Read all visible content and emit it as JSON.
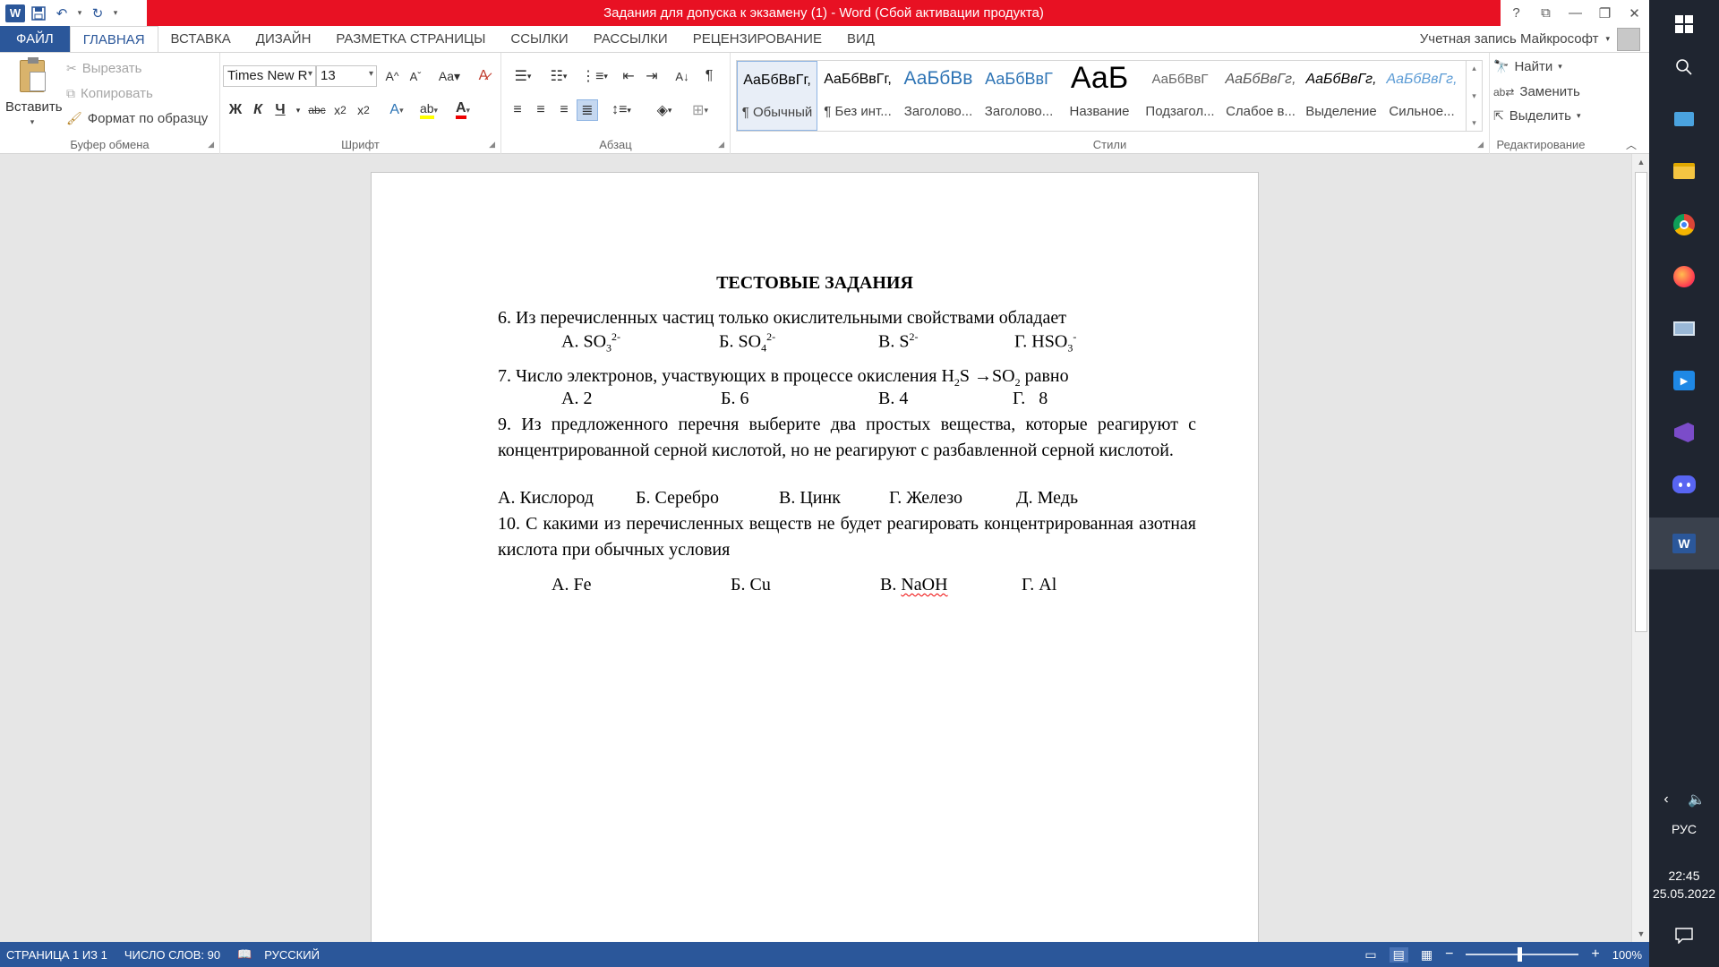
{
  "window": {
    "title": "Задания для допуска к экзамену (1) -  Word (Сбой активации продукта)",
    "controls": [
      "?",
      "⧉",
      "—",
      "❐",
      "✕"
    ]
  },
  "qat": {
    "icons": [
      "word-logo",
      "save-icon",
      "undo-icon",
      "redo-icon",
      "customize-icon"
    ]
  },
  "tabs": [
    {
      "label": "ФАЙЛ"
    },
    {
      "label": "ГЛАВНАЯ"
    },
    {
      "label": "ВСТАВКА"
    },
    {
      "label": "ДИЗАЙН"
    },
    {
      "label": "РАЗМЕТКА СТРАНИЦЫ"
    },
    {
      "label": "ССЫЛКИ"
    },
    {
      "label": "РАССЫЛКИ"
    },
    {
      "label": "РЕЦЕНЗИРОВАНИЕ"
    },
    {
      "label": "ВИД"
    }
  ],
  "account": {
    "label": "Учетная запись Майкрософт"
  },
  "ribbon": {
    "clipboard": {
      "group_label": "Буфер обмена",
      "paste": "Вставить",
      "cut": "Вырезать",
      "copy": "Копировать",
      "format_painter": "Формат по образцу"
    },
    "font": {
      "group_label": "Шрифт",
      "font_name": "Times New R",
      "font_size": "13"
    },
    "paragraph": {
      "group_label": "Абзац"
    },
    "styles": {
      "group_label": "Стили",
      "items": [
        {
          "sample": "АаБбВвГг,",
          "name": "¶ Обычный"
        },
        {
          "sample": "АаБбВвГг,",
          "name": "¶ Без инт..."
        },
        {
          "sample": "АаБбВв",
          "name": "Заголово..."
        },
        {
          "sample": "АаБбВвГ",
          "name": "Заголово..."
        },
        {
          "sample": "АаБ",
          "name": "Название"
        },
        {
          "sample": "АаБбВвГ",
          "name": "Подзагол..."
        },
        {
          "sample": "АаБбВвГг,",
          "name": "Слабое в..."
        },
        {
          "sample": "АаБбВвГг,",
          "name": "Выделение"
        },
        {
          "sample": "АаБбВвГг,",
          "name": "Сильное..."
        }
      ]
    },
    "editing": {
      "group_label": "Редактирование",
      "find": "Найти",
      "replace": "Заменить",
      "select": "Выделить"
    }
  },
  "document": {
    "title": "ТЕСТОВЫЕ ЗАДАНИЯ",
    "q6": {
      "text": "6. Из перечисленных частиц только окислительными свойствами обладает",
      "a": {
        "prefix": "А. SO",
        "sub": "3",
        "sup": "2-"
      },
      "b": {
        "prefix": "Б. SO",
        "sub": "4",
        "sup": "2-"
      },
      "c": {
        "prefix": "В. S",
        "sup": "2-"
      },
      "d": {
        "prefix": "Г. HSO",
        "sub": "3",
        "sup": "-"
      }
    },
    "q7": {
      "text_before": "7. Число электронов, участвующих в процессе окисления H",
      "sub1": "2",
      "mid": "S →SO",
      "sub2": "2",
      "text_after": " равно",
      "a": "А. 2",
      "b": "Б. 6",
      "c": "В. 4",
      "d": "Г.   8"
    },
    "q9": {
      "text": "9. Из предложенного перечня выберите два простых вещества, которые реагируют с концентрированной серной кислотой, но не реагируют с разбавленной серной кислотой.",
      "a": "А. Кислород",
      "b": "Б. Серебро",
      "c": "В. Цинк",
      "d": "Г. Железо",
      "e": "Д. Медь"
    },
    "q10": {
      "text": "10. С какими из перечисленных веществ не будет реагировать концентрированная азотная кислота при обычных условия",
      "a": "А. Fe",
      "b": "Б. Cu",
      "c_prefix": "В. ",
      "c_word": "NaOH",
      "d": "Г. Al"
    }
  },
  "statusbar": {
    "page": "СТРАНИЦА 1 ИЗ 1",
    "words": "ЧИСЛО СЛОВ: 90",
    "language": "РУССКИЙ",
    "zoom": "100%",
    "zoom_level_percent": 100
  },
  "taskbar": {
    "language": "РУС",
    "time": "22:45",
    "date": "25.05.2022"
  },
  "colors": {
    "accent": "#2b579a",
    "title_bg": "#e81123",
    "taskbar": "#1f2530"
  }
}
